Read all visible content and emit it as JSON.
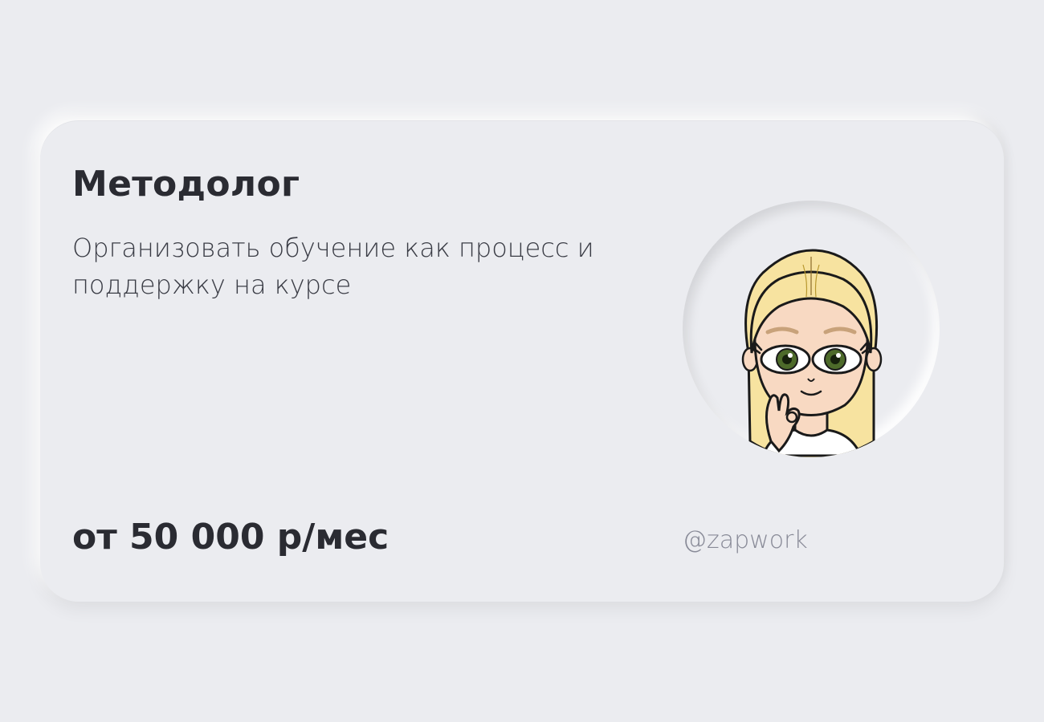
{
  "card": {
    "title": "Методолог",
    "description": "Организовать обучение как процесс и поддержку на курсе",
    "price": "от 50 000 р/мес",
    "handle": "@zapwork",
    "avatar_icon": "cartoon-girl-avatar"
  },
  "colors": {
    "background": "#ebecf0",
    "text_primary": "#2a2b32",
    "text_secondary": "#888a97",
    "hair": "#f7e3a0",
    "skin": "#f8d9c2",
    "eyes": "#4d6a2a"
  }
}
